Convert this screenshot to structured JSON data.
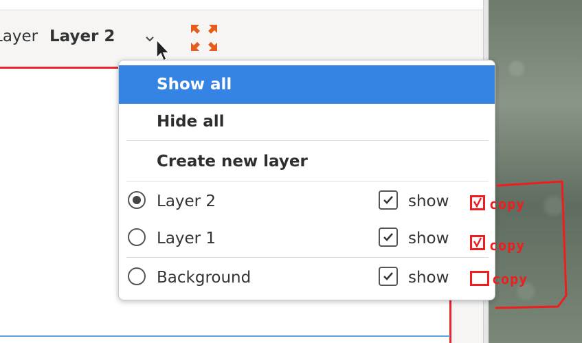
{
  "toolbar": {
    "layer_label": "Layer",
    "current_layer": "Layer 2"
  },
  "menu": {
    "items": [
      {
        "label": "Show all",
        "highlighted": true
      },
      {
        "label": "Hide all"
      },
      {
        "label": "Create new layer"
      }
    ],
    "layers": [
      {
        "name": "Layer 2",
        "selected": true,
        "show": true,
        "show_label": "show"
      },
      {
        "name": "Layer 1",
        "selected": false,
        "show": true,
        "show_label": "show"
      },
      {
        "name": "Background",
        "selected": false,
        "show": true,
        "show_label": "show"
      }
    ]
  },
  "annotations": {
    "copy_labels": [
      "copy",
      "copy",
      "copy"
    ],
    "copy_checked": [
      true,
      true,
      false
    ]
  },
  "colors": {
    "highlight": "#3584e4",
    "canvas_border": "#e8242c",
    "annotation": "#ef1d1d",
    "expand_icon": "#e65c1a"
  },
  "icons": {
    "dropdown": "chevron-down-icon",
    "expand": "expand-arrows-icon",
    "cursor": "mouse-pointer-icon"
  }
}
